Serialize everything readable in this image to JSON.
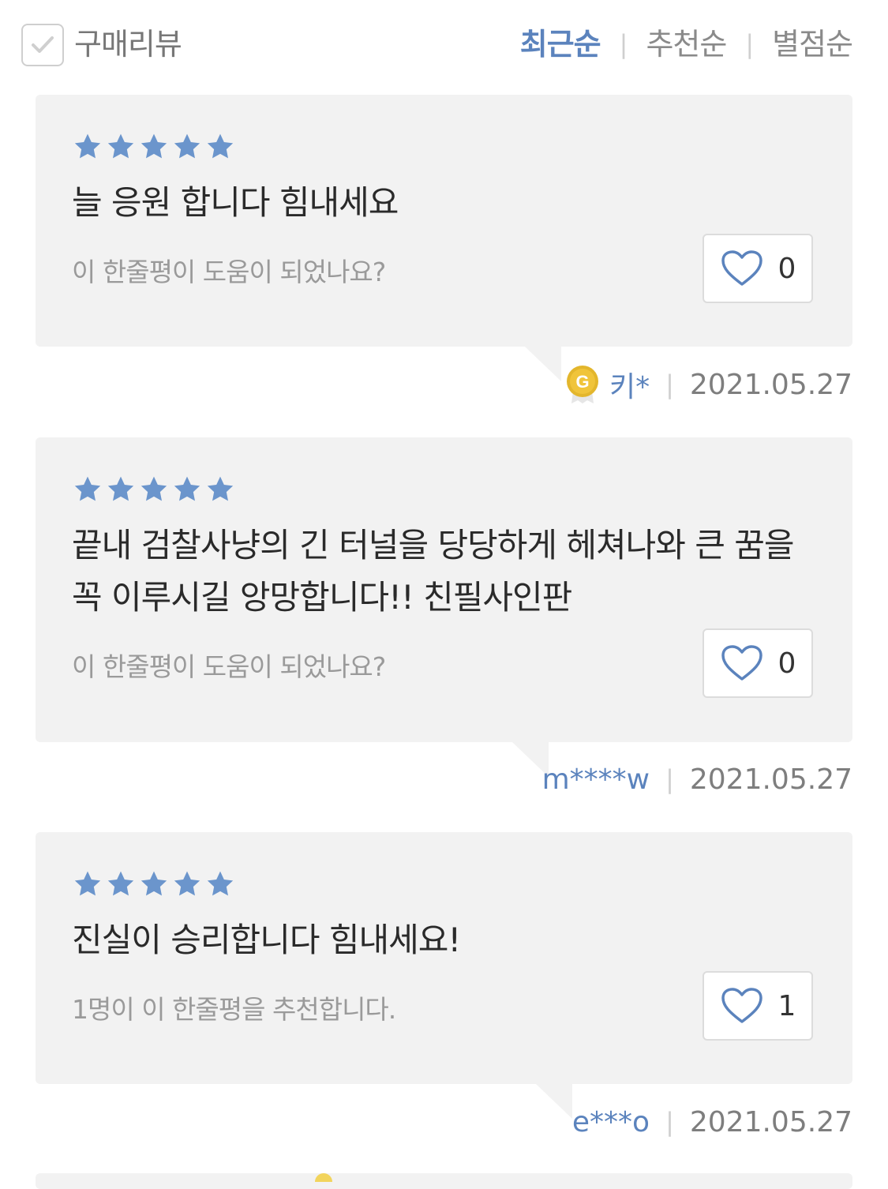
{
  "header": {
    "filter_label": "구매리뷰",
    "filter_checked": true,
    "sort_tabs": [
      {
        "label": "최근순",
        "active": true
      },
      {
        "label": "추천순",
        "active": false
      },
      {
        "label": "별점순",
        "active": false
      }
    ],
    "separator": "|"
  },
  "reviews": [
    {
      "rating": 5,
      "text": "늘 응원 합니다 힘내세요",
      "helpful_text": "이 한줄평이 도움이 되었나요?",
      "likes": "0",
      "user": "키*",
      "user_badge": "G",
      "date": "2021.05.27"
    },
    {
      "rating": 5,
      "text": "끝내 검찰사냥의 긴 터널을 당당하게 헤쳐나와 큰 꿈을 꼭 이루시길 앙망합니다!! 친필사인판",
      "helpful_text": "이 한줄평이 도움이 되었나요?",
      "likes": "0",
      "user": "m****w",
      "date": "2021.05.27"
    },
    {
      "rating": 5,
      "text": "진실이 승리합니다 힘내세요!",
      "helpful_text": "1명이 이 한줄평을 추천합니다.",
      "likes": "1",
      "user": "e***o",
      "date": "2021.05.27"
    }
  ],
  "colors": {
    "accent": "#5b83bd",
    "star": "#6b95cc",
    "card_bg": "#f2f2f2",
    "badge_gold": "#e3b62c"
  },
  "icons": {
    "filter_check": "check-icon",
    "star": "star-icon",
    "like": "heart-icon",
    "badge": "grade-badge-icon"
  }
}
